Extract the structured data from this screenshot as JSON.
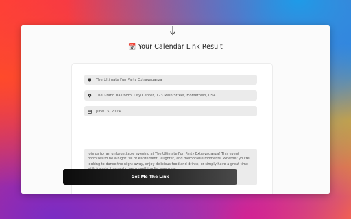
{
  "header": {
    "title": "Your Calendar Link Result",
    "title_icon": "calendar-icon",
    "scroll_hint_icon": "arrow-down-icon"
  },
  "form": {
    "event_title": {
      "icon": "cup-icon",
      "value": "The Ultimate Fun Party Extravaganza"
    },
    "location": {
      "icon": "map-pin-icon",
      "value": "The Grand Ballroom, City Center, 123 Main Street, Hometown, USA"
    },
    "date": {
      "icon": "calendar-icon",
      "value": "June 15, 2024"
    },
    "description": "Join us for an unforgettable evening at The Ultimate Fun Party Extravaganza! This event promises to be a night full of excitement, laughter, and memorable moments. Whether you're looking to dance the night away, enjoy delicious food and drinks, or simply have a great time with friends, this party has something for everyone."
  },
  "cta": {
    "label": "Get Me The Link"
  },
  "colors": {
    "button_dark": "#0c0c0c",
    "field_bg": "#ebebeb",
    "card_bg": "#ffffff"
  }
}
